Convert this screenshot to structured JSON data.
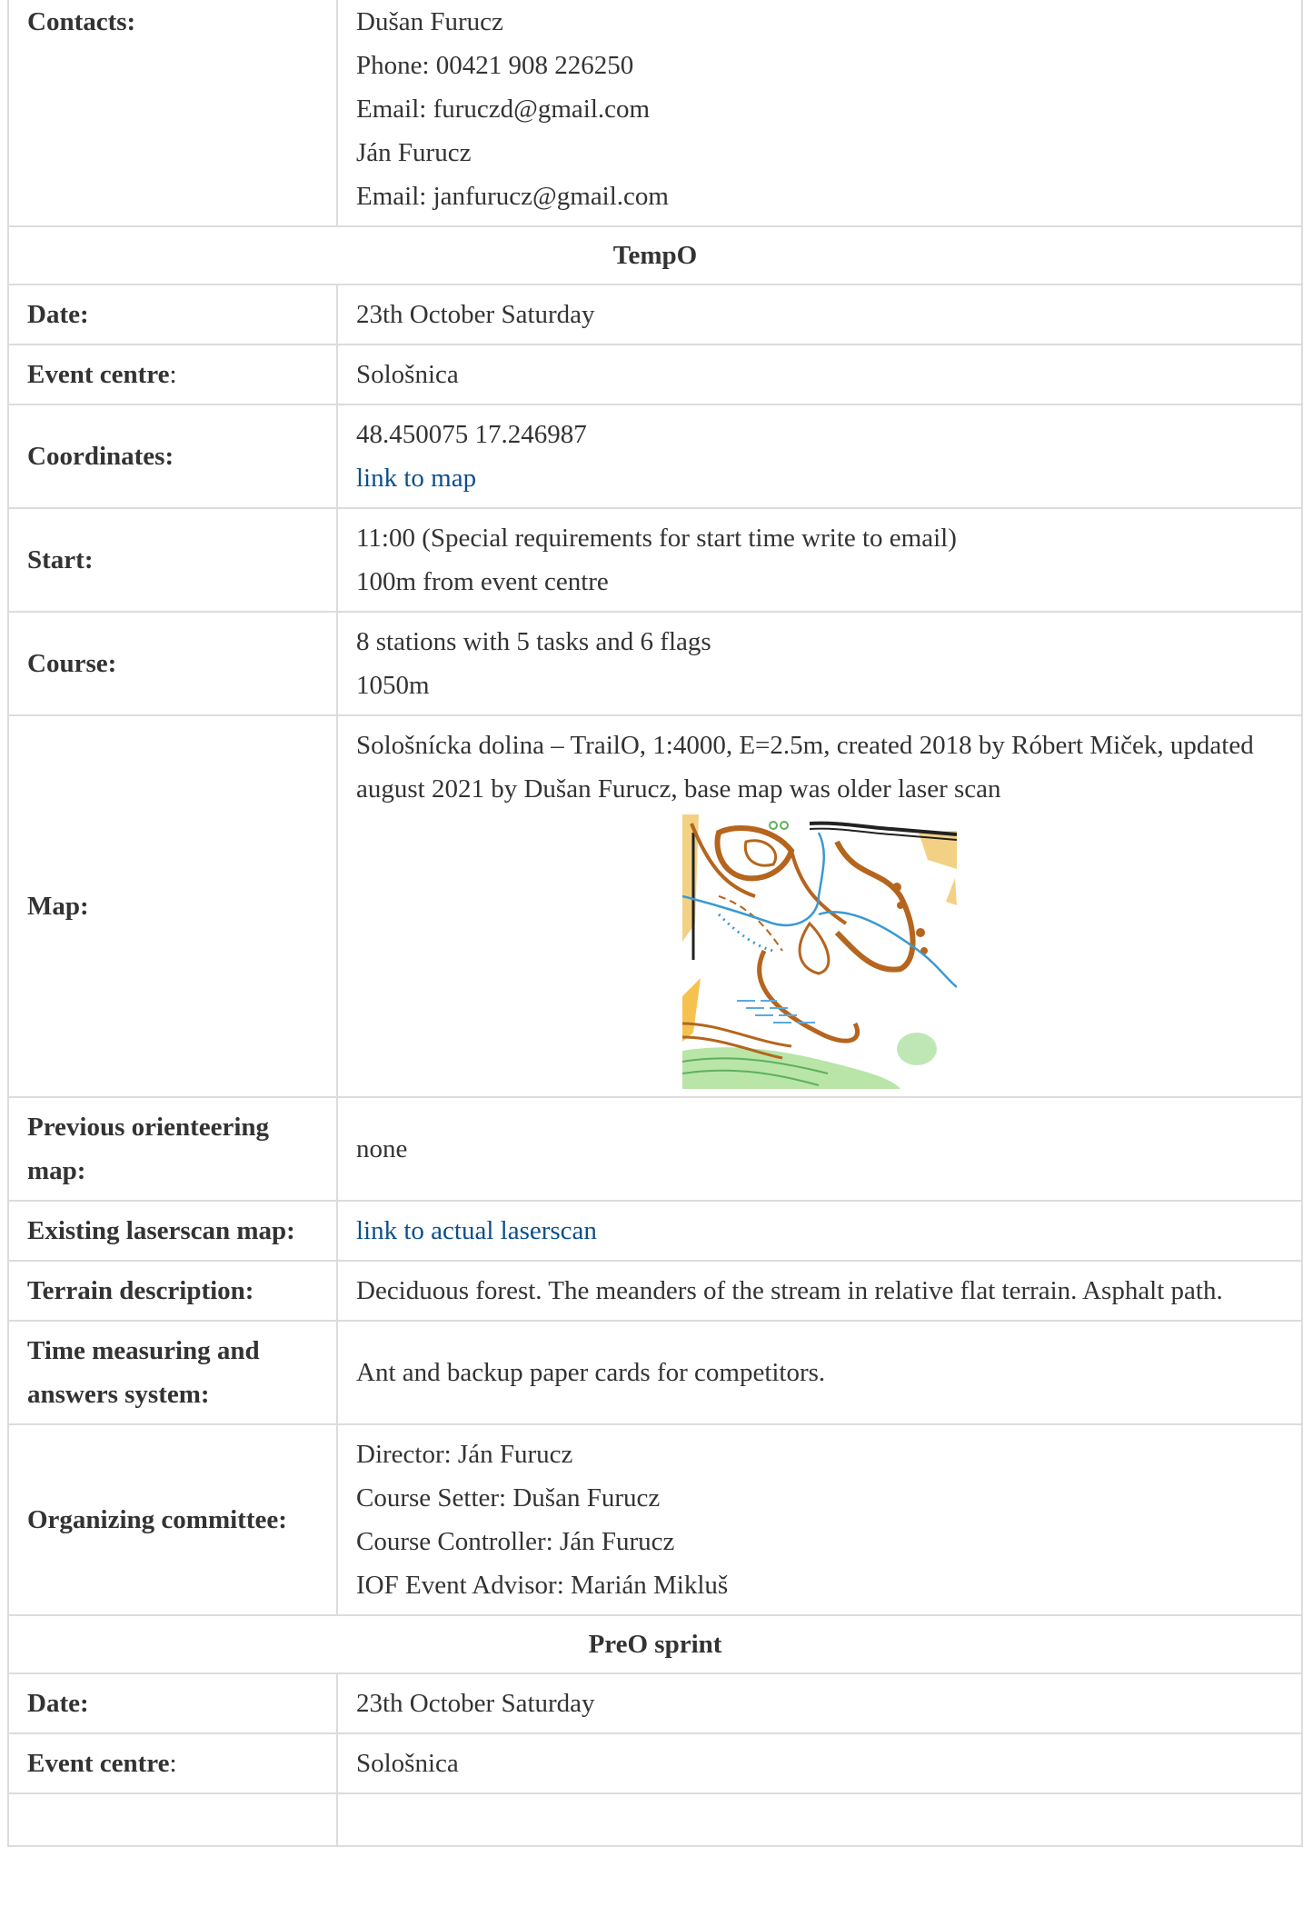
{
  "contacts": {
    "label": "Contacts:",
    "lines": [
      "Dušan Furucz",
      "Phone: 00421 908 226250",
      "Email: furuczd@gmail.com",
      "Ján Furucz",
      "Email: janfurucz@gmail.com"
    ]
  },
  "tempo": {
    "title": "TempO",
    "date": {
      "label": "Date:",
      "value": "23th October Saturday"
    },
    "event_centre": {
      "label": "Event centre",
      "label_suffix": ":",
      "value": "Sološnica"
    },
    "coordinates": {
      "label": "Coordinates:",
      "value": "48.450075 17.246987",
      "link": "link to map"
    },
    "start": {
      "label": "Start:",
      "lines": [
        "11:00 (Special requirements for start time write to email)",
        "100m from event centre"
      ]
    },
    "course": {
      "label": "Course:",
      "lines": [
        "8 stations with 5 tasks and 6 flags",
        "1050m"
      ]
    },
    "map": {
      "label": "Map:",
      "description": "Sološnícka dolina – TrailO, 1:4000, E=2.5m, created 2018 by Róbert Miček, updated august 2021 by Dušan Furucz, base map was older laser scan"
    },
    "previous_map": {
      "label": "Previous orienteering map:",
      "value": "none"
    },
    "laserscan": {
      "label": "Existing laserscan map:",
      "link": "link to actual laserscan"
    },
    "terrain": {
      "label": "Terrain description:",
      "value": "Deciduous forest. The meanders of the stream in relative flat terrain. Asphalt path."
    },
    "timing": {
      "label": "Time measuring and answers system:",
      "value": "Ant and backup paper cards for competitors."
    },
    "committee": {
      "label": "Organizing committee:",
      "lines": [
        "Director: Ján Furucz",
        "Course Setter: Dušan Furucz",
        "Course Controller: Ján Furucz",
        "IOF Event Advisor: Marián Mikluš"
      ]
    }
  },
  "preo": {
    "title": "PreO sprint",
    "date": {
      "label": "Date:",
      "value": "23th October Saturday"
    },
    "event_centre": {
      "label": "Event centre",
      "label_suffix": ":",
      "value": "Sološnica"
    }
  },
  "colors": {
    "text": "#333333",
    "link": "#0b4f8a",
    "border": "#dcdcdc"
  }
}
